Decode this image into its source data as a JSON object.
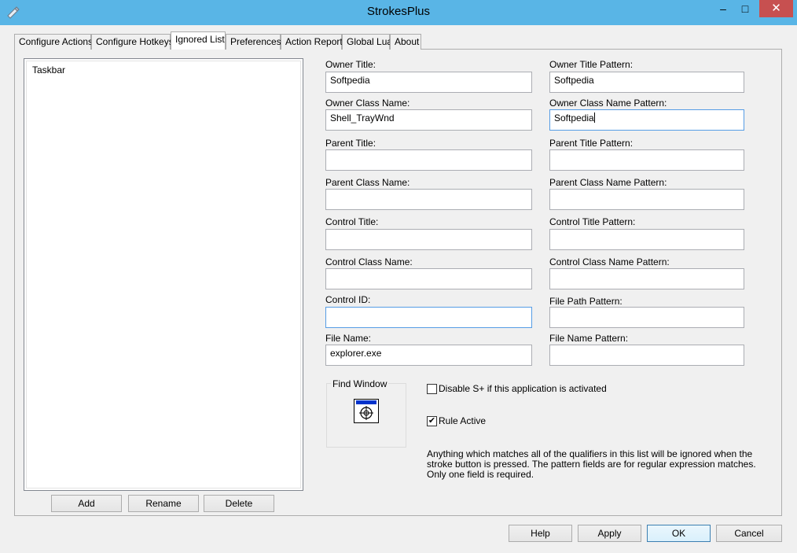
{
  "window": {
    "title": "StrokesPlus",
    "minimize": "–",
    "maximize": "□",
    "close": "✕"
  },
  "tabs": [
    {
      "label": "Configure Actions"
    },
    {
      "label": "Configure Hotkeys"
    },
    {
      "label": "Ignored List"
    },
    {
      "label": "Preferences"
    },
    {
      "label": "Action Report"
    },
    {
      "label": "Global Lua"
    },
    {
      "label": "About"
    }
  ],
  "active_tab": "Ignored List",
  "ignored_list": {
    "items": [
      "Taskbar"
    ]
  },
  "list_buttons": {
    "add": "Add",
    "rename": "Rename",
    "delete": "Delete"
  },
  "fields": {
    "owner_title": {
      "label": "Owner Title:",
      "value": "Softpedia"
    },
    "owner_title_pattern": {
      "label": "Owner Title Pattern:",
      "value": "Softpedia"
    },
    "owner_class_name": {
      "label": "Owner Class Name:",
      "value": "Shell_TrayWnd"
    },
    "owner_class_name_pattern": {
      "label": "Owner Class Name Pattern:",
      "value": "Softpedia"
    },
    "parent_title": {
      "label": "Parent Title:",
      "value": ""
    },
    "parent_title_pattern": {
      "label": "Parent Title Pattern:",
      "value": ""
    },
    "parent_class_name": {
      "label": "Parent Class Name:",
      "value": ""
    },
    "parent_class_name_pattern": {
      "label": "Parent Class Name Pattern:",
      "value": ""
    },
    "control_title": {
      "label": "Control Title:",
      "value": ""
    },
    "control_title_pattern": {
      "label": "Control Title Pattern:",
      "value": ""
    },
    "control_class_name": {
      "label": "Control Class Name:",
      "value": ""
    },
    "control_class_name_pattern": {
      "label": "Control Class Name Pattern:",
      "value": ""
    },
    "control_id": {
      "label": "Control ID:",
      "value": ""
    },
    "file_path_pattern": {
      "label": "File Path Pattern:",
      "value": ""
    },
    "file_name": {
      "label": "File Name:",
      "value": "explorer.exe"
    },
    "file_name_pattern": {
      "label": "File Name Pattern:",
      "value": ""
    }
  },
  "find_window": {
    "label": "Find Window",
    "icon": "crosshair-target-icon"
  },
  "options": {
    "disable_splus": {
      "label": "Disable S+ if this application is activated",
      "checked": false
    },
    "rule_active": {
      "label": "Rule Active",
      "checked": true,
      "mark": "✔"
    }
  },
  "info_text": "Anything which matches all of the qualifiers in this list will be ignored when the stroke button is pressed. The pattern fields are for regular expression matches. Only one field is required.",
  "dialog_buttons": {
    "help": "Help",
    "apply": "Apply",
    "ok": "OK",
    "cancel": "Cancel"
  },
  "colors": {
    "titlebar": "#59b5e6",
    "close_button": "#c75050",
    "focus_border": "#569de5"
  }
}
